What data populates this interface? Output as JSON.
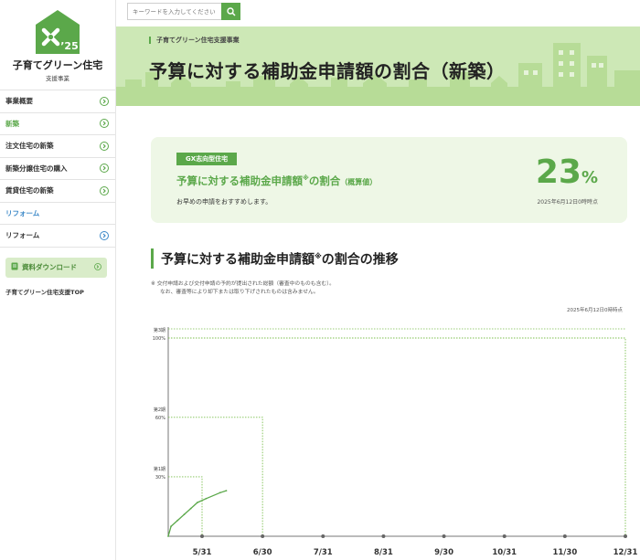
{
  "logo": {
    "year": "’25",
    "title": "子育てグリーン住宅",
    "subtitle": "支援事業"
  },
  "sidebar": {
    "items": [
      {
        "label": "事業概要"
      },
      {
        "label": "新築"
      },
      {
        "label": "注文住宅の新築"
      },
      {
        "label": "新築分譲住宅の購入"
      },
      {
        "label": "賃貸住宅の新築"
      },
      {
        "label": "リフォーム"
      },
      {
        "label": "リフォーム"
      }
    ],
    "download_label": "資料ダウンロード",
    "top_link": "子育てグリーン住宅支援TOP"
  },
  "search": {
    "placeholder": "キーワードを入力してください"
  },
  "hero": {
    "pretitle": "子育てグリーン住宅支援事業",
    "title": "予算に対する補助金申請額の割合（新築）"
  },
  "card": {
    "badge": "GX志向型住宅",
    "main_text": "予算に対する補助金申請額",
    "main_mark": "※",
    "main_tail": "の割合",
    "main_small": "（概算値）",
    "note": "お早めの申請をおすすめします。",
    "percent": "23",
    "percent_unit": "%",
    "date": "2025年6月12日0時時点"
  },
  "section": {
    "title": "予算に対する補助金申請額",
    "title_mark": "※",
    "title_tail": "の割合の推移",
    "note1": "※ 交付申請および交付申請の予約が提出された総額（審査中のものも含む）。",
    "note2": "なお、審査等により却下または取り下げされたものは含みません。",
    "date": "2025年6月12日0時時点"
  },
  "chart_data": {
    "type": "line",
    "x_ticks": [
      "5/31",
      "6/30",
      "7/31",
      "8/31",
      "9/30",
      "10/31",
      "11/30",
      "12/31"
    ],
    "thresholds": [
      {
        "period": "第1期",
        "percent_label": "30%",
        "value": 30,
        "until": "5/31"
      },
      {
        "period": "第2期",
        "percent_label": "60%",
        "value": 60,
        "until": "6/30"
      },
      {
        "period": "第3期",
        "percent_label": "100%",
        "value": 100,
        "until": "12/31"
      }
    ],
    "ylim": [
      0,
      100
    ],
    "series": [
      {
        "values": [
          {
            "x": "4/25",
            "y": 0
          },
          {
            "x": "4/28",
            "y": 5
          },
          {
            "x": "5/5",
            "y": 8
          },
          {
            "x": "5/12",
            "y": 11
          },
          {
            "x": "5/19",
            "y": 14
          },
          {
            "x": "5/26",
            "y": 17
          },
          {
            "x": "6/2",
            "y": 19
          },
          {
            "x": "6/9",
            "y": 22
          },
          {
            "x": "6/12",
            "y": 23
          }
        ]
      }
    ],
    "colors": {
      "line": "#5ba84a",
      "threshold": "#7bbf4e",
      "axis": "#777777"
    }
  }
}
